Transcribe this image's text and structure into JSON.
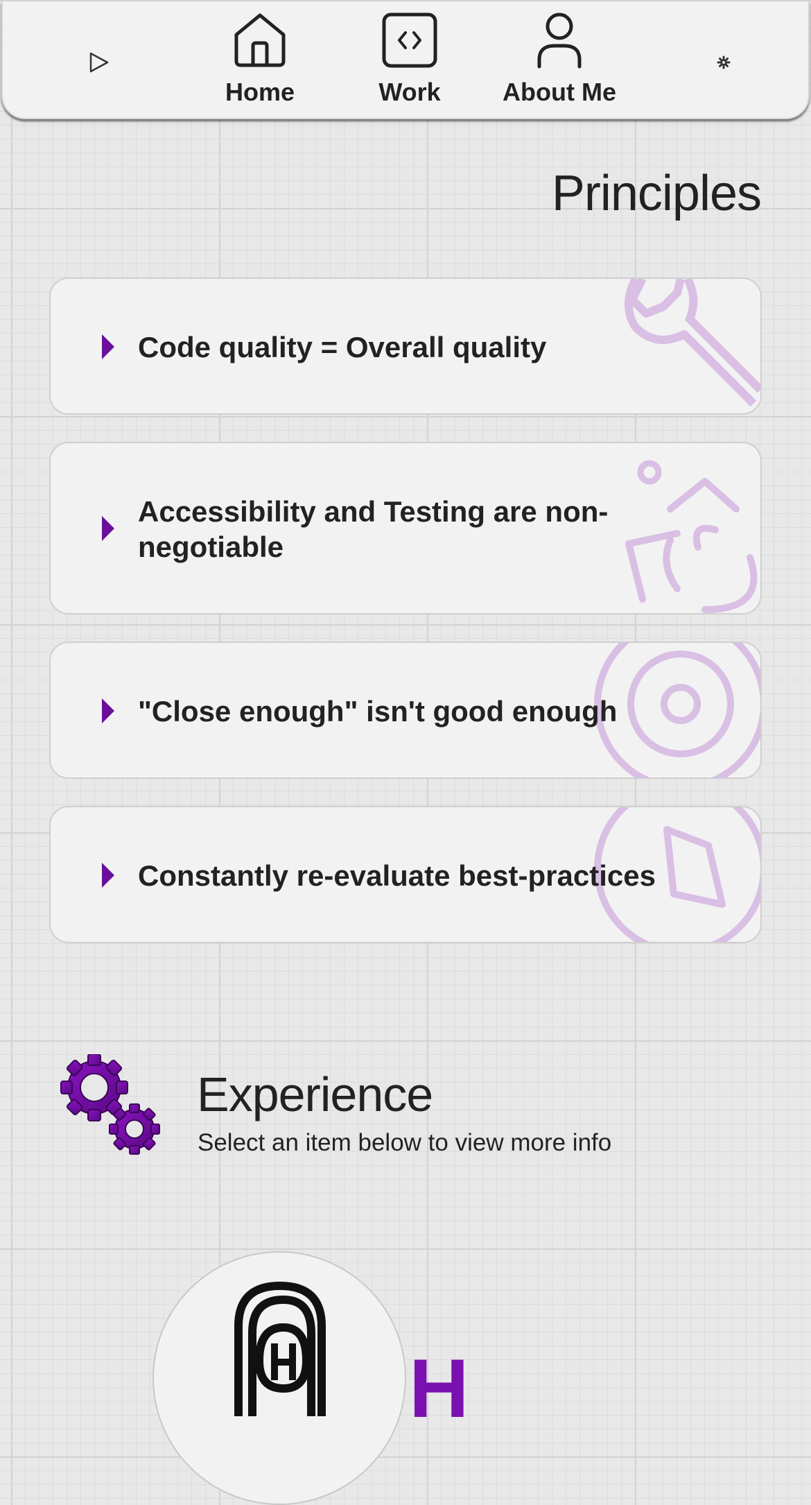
{
  "nav": {
    "items": [
      {
        "label": "Home",
        "icon": "house-icon"
      },
      {
        "label": "Work",
        "icon": "code-icon"
      },
      {
        "label": "About Me",
        "icon": "person-icon"
      }
    ],
    "play_icon": "play-icon",
    "settings_icon": "gear-icon"
  },
  "principles": {
    "title": "Principles",
    "items": [
      {
        "text": "Code quality = Overall quality",
        "icon": "wrench-icon"
      },
      {
        "text": "Accessibility and Testing are non-negotiable",
        "icon": "wheelchair-icon"
      },
      {
        "text": "\"Close enough\" isn't good enough",
        "icon": "target-icon"
      },
      {
        "text": "Constantly re-evaluate best-practices",
        "icon": "compass-icon"
      }
    ]
  },
  "experience": {
    "title": "Experience",
    "subtitle": "Select an item below to view more info",
    "icon": "gears-icon"
  },
  "colors": {
    "accent": "#6b0f9b",
    "watermark": "#d9bfe4",
    "card_bg": "#f2f2f2",
    "text": "#222222"
  }
}
